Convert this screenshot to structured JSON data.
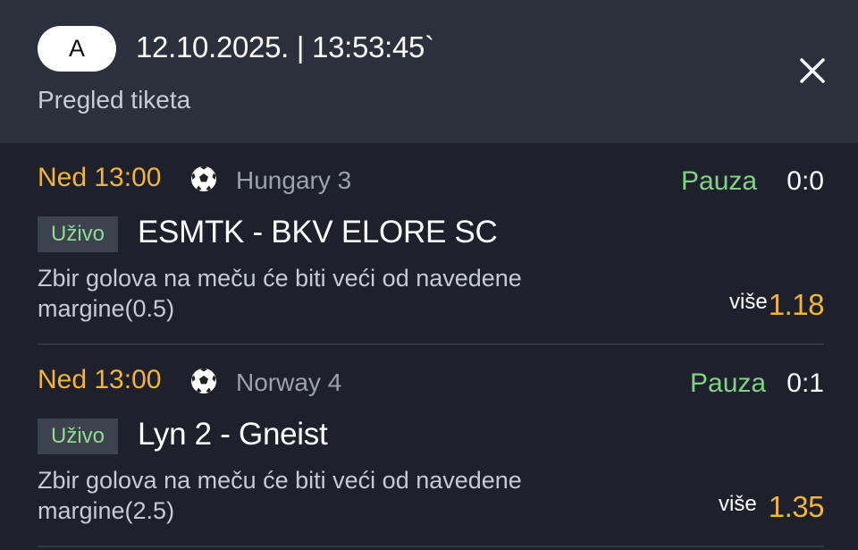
{
  "header": {
    "badge": "A",
    "datetime": "12.10.2025. | 13:53:45`",
    "subtitle": "Pregled tiketa",
    "close_icon": "close-icon"
  },
  "tickets": [
    {
      "time": "Ned 13:00",
      "sport_icon": "soccer-ball-icon",
      "league": "Hungary 3",
      "status": "Pauza",
      "score": "0:0",
      "live_label": "Uživo",
      "match": "ESMTK - BKV ELORE SC",
      "market": "Zbir golova na meču će biti veći od navedene margine(0.5)",
      "pick": "više",
      "odds": "1.18"
    },
    {
      "time": "Ned 13:00",
      "sport_icon": "soccer-ball-icon",
      "league": "Norway 4",
      "status": "Pauza",
      "score": "0:1",
      "live_label": "Uživo",
      "match": "Lyn 2 - Gneist",
      "market": "Zbir golova na meču će biti veći od navedene margine(2.5)",
      "pick": "više",
      "odds": "1.35"
    }
  ],
  "colors": {
    "header_bg": "#2c303c",
    "body_bg": "#1e212b",
    "accent_orange": "#f1b43c",
    "status_green": "#83d186"
  }
}
